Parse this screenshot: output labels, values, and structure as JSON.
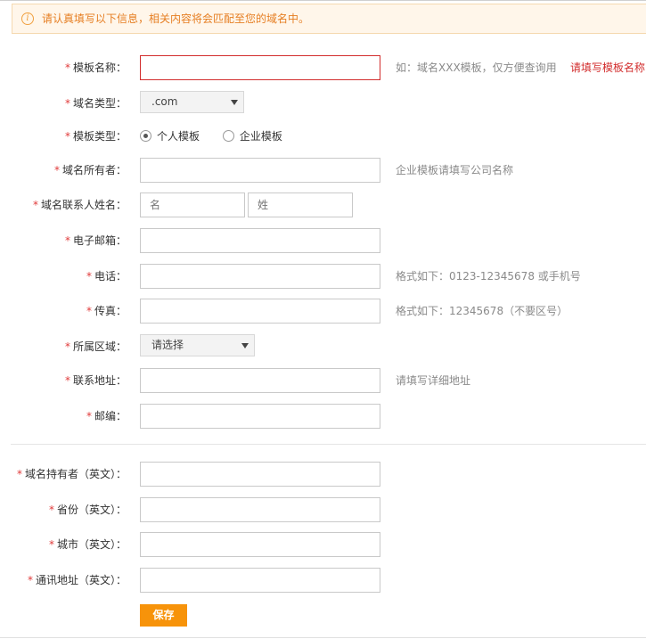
{
  "notice": {
    "text": "请认真填写以下信息，相关内容将会匹配至您的域名中。"
  },
  "form": {
    "template_name": {
      "label": "模板名称：",
      "value": "",
      "hint": "如：域名XXX模板，仅方便查询用",
      "error": "请填写模板名称"
    },
    "domain_type": {
      "label": "域名类型：",
      "selected": ".com"
    },
    "template_type": {
      "label": "模板类型：",
      "options": [
        "个人模板",
        "企业模板"
      ],
      "selected": "个人模板"
    },
    "owner": {
      "label": "域名所有者：",
      "value": "",
      "hint": "企业模板请填写公司名称"
    },
    "contact_name": {
      "label": "域名联系人姓名：",
      "first_placeholder": "名",
      "last_placeholder": "姓"
    },
    "email": {
      "label": "电子邮箱：",
      "value": ""
    },
    "phone": {
      "label": "电话：",
      "value": "",
      "hint": "格式如下：0123-12345678 或手机号"
    },
    "fax": {
      "label": "传真：",
      "value": "",
      "hint": "格式如下：12345678（不要区号）"
    },
    "region": {
      "label": "所属区域：",
      "selected": "请选择"
    },
    "address": {
      "label": "联系地址：",
      "value": "",
      "hint": "请填写详细地址"
    },
    "postcode": {
      "label": "邮编：",
      "value": ""
    },
    "owner_en": {
      "label": "域名持有者（英文）：",
      "value": ""
    },
    "province_en": {
      "label": "省份（英文）：",
      "value": ""
    },
    "city_en": {
      "label": "城市（英文）：",
      "value": ""
    },
    "address_en": {
      "label": "通讯地址（英文）：",
      "value": ""
    },
    "required_mark": "*",
    "save_label": "保存"
  },
  "colors": {
    "accent": "#f7930a",
    "error": "#d22d2d",
    "notice_bg": "#fff6ea",
    "notice_text": "#e67e22"
  }
}
